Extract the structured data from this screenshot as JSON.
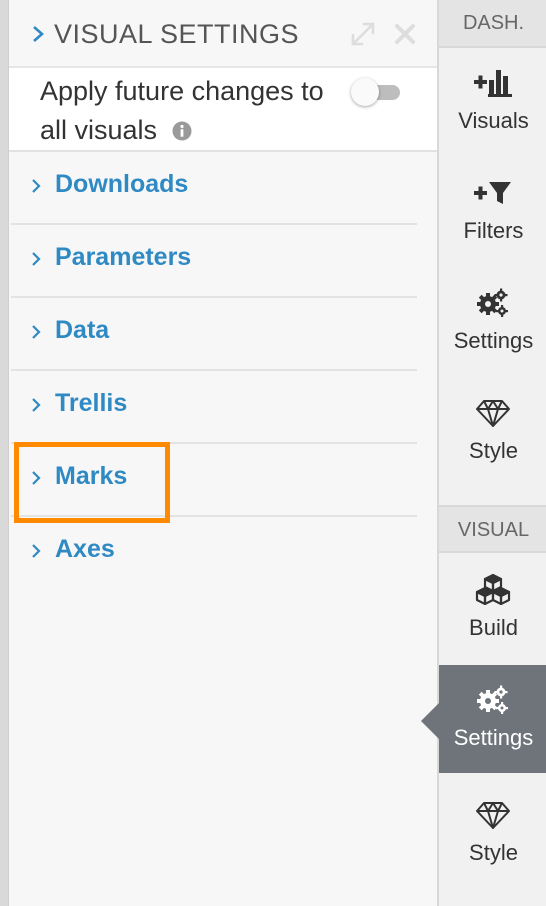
{
  "panel": {
    "title": "VISUAL SETTINGS",
    "apply_label": "Apply future changes to all visuals",
    "apply_toggle_on": false
  },
  "accordion": {
    "items": [
      {
        "label": "Downloads"
      },
      {
        "label": "Parameters"
      },
      {
        "label": "Data"
      },
      {
        "label": "Trellis"
      },
      {
        "label": "Marks"
      },
      {
        "label": "Axes"
      }
    ]
  },
  "sidebar": {
    "dash_label": "DASH.",
    "visual_label": "VISUAL",
    "dash_items": [
      {
        "label": "Visuals",
        "icon": "add-chart-icon"
      },
      {
        "label": "Filters",
        "icon": "add-filter-icon"
      },
      {
        "label": "Settings",
        "icon": "gears-icon"
      },
      {
        "label": "Style",
        "icon": "diamond-icon"
      }
    ],
    "visual_items": [
      {
        "label": "Build",
        "icon": "cubes-icon"
      },
      {
        "label": "Settings",
        "icon": "gears-icon",
        "active": true
      },
      {
        "label": "Style",
        "icon": "diamond-icon"
      }
    ]
  },
  "colors": {
    "accent": "#2f8ac4",
    "highlight": "#ff8a00",
    "active_nav": "#6e7479"
  }
}
